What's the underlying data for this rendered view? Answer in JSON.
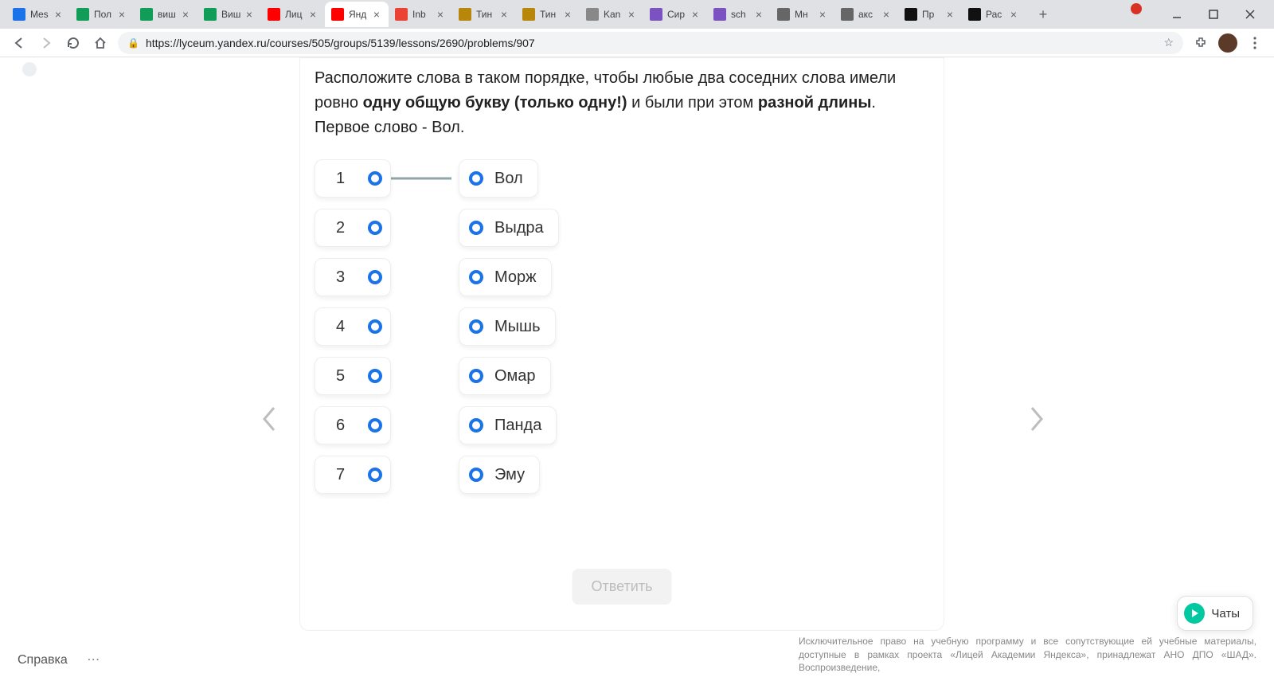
{
  "browser": {
    "tabs": [
      {
        "title": "Mes",
        "favicon": "#1a73e8"
      },
      {
        "title": "Пол",
        "favicon": "#0f9d58"
      },
      {
        "title": "виш",
        "favicon": "#0f9d58"
      },
      {
        "title": "Виш",
        "favicon": "#0f9d58"
      },
      {
        "title": "Лиц",
        "favicon": "#ff0000"
      },
      {
        "title": "Янд",
        "favicon": "#ff0000",
        "active": true
      },
      {
        "title": "Inb",
        "favicon": "#ea4335"
      },
      {
        "title": "Тин",
        "favicon": "#b8860b"
      },
      {
        "title": "Тин",
        "favicon": "#b8860b"
      },
      {
        "title": "Kan",
        "favicon": "#888"
      },
      {
        "title": "Сир",
        "favicon": "#7b53c1"
      },
      {
        "title": "sch",
        "favicon": "#7b53c1"
      },
      {
        "title": "Мн",
        "favicon": "#666"
      },
      {
        "title": "акс",
        "favicon": "#666"
      },
      {
        "title": "Пр",
        "favicon": "#111"
      },
      {
        "title": "Рас",
        "favicon": "#111"
      }
    ],
    "url": "https://lyceum.yandex.ru/courses/505/groups/5139/lessons/2690/problems/907"
  },
  "task": {
    "line1a": "Расположите слова в таком порядке, чтобы любые два соседних слова имели ровно ",
    "bold1": "одну общую букву (только одну!)",
    "mid1": " и были при этом ",
    "bold2": "разной длины",
    "end1": ".",
    "line2": "Первое слово - Вол."
  },
  "slots": [
    "1",
    "2",
    "3",
    "4",
    "5",
    "6",
    "7"
  ],
  "words": [
    "Вол",
    "Выдра",
    "Морж",
    "Мышь",
    "Омар",
    "Панда",
    "Эму"
  ],
  "connections": [
    [
      0,
      0
    ]
  ],
  "answer_button": "Ответить",
  "help_label": "Справка",
  "chat_label": "Чаты",
  "legal": "Исключительное право на учебную программу и все сопутствующие ей учебные материалы, доступные в рамках проекта «Лицей Академии Яндекса», принадлежат АНО ДПО «ШАД». Воспроизведение,"
}
